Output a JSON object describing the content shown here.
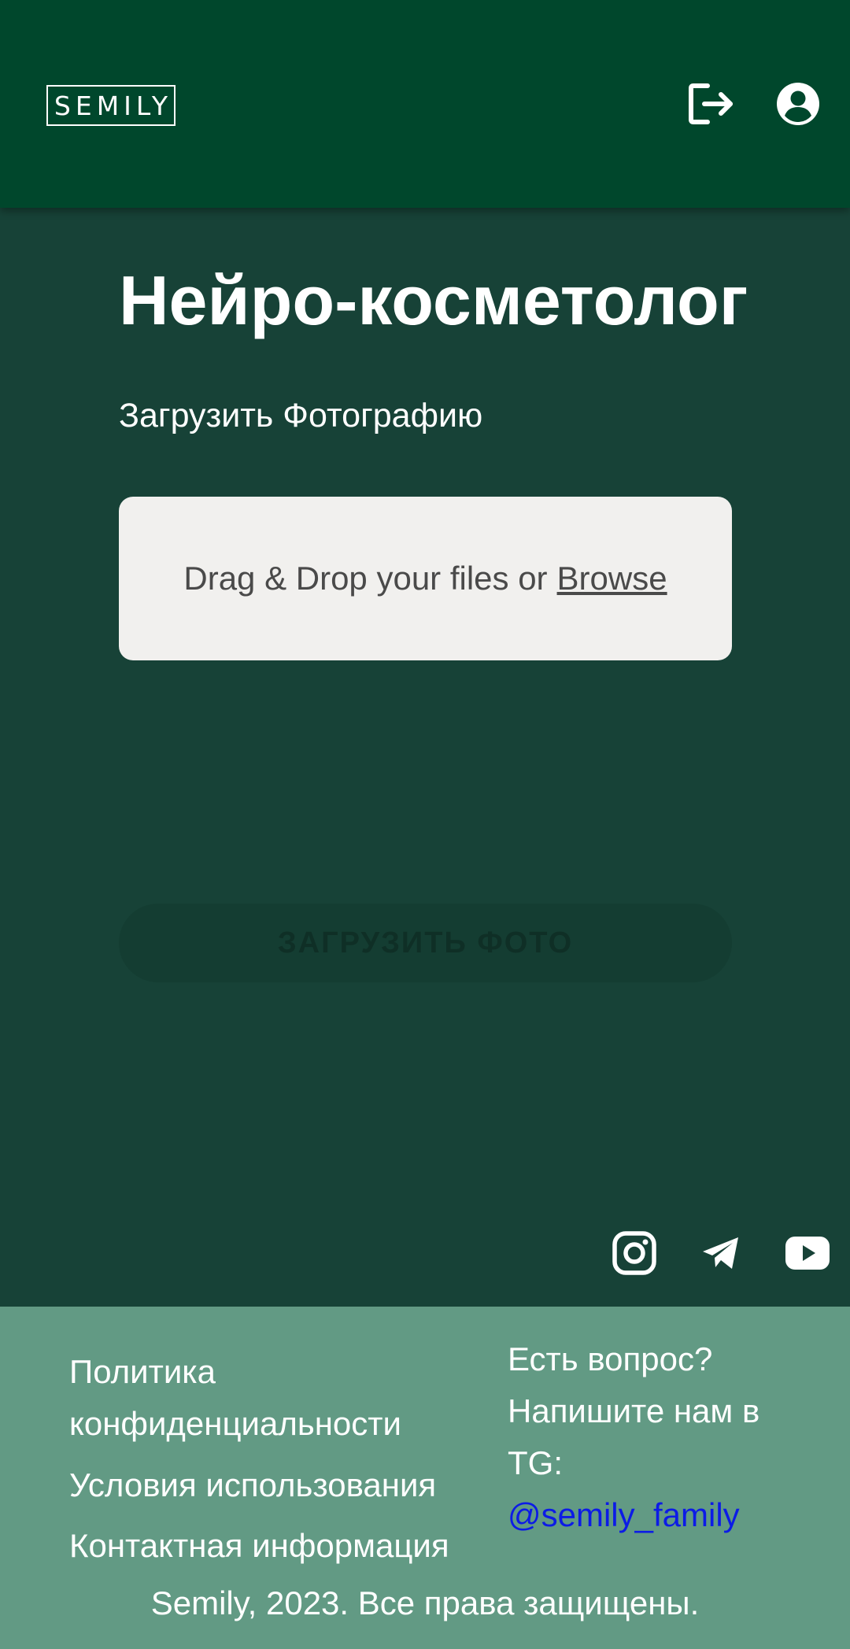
{
  "header": {
    "logo_text": "SEMILY",
    "icons": {
      "logout": "logout-icon",
      "account": "account-circle-icon"
    },
    "colors": {
      "background": "#00472c",
      "icon": "#ffffff"
    }
  },
  "main": {
    "title": "Нейро-косметолог",
    "upload_label": "Загрузить Фотографию",
    "dropzone": {
      "text": "Drag & Drop your files or",
      "browse_link": "Browse"
    },
    "upload_button": {
      "label": "ЗАГРУЗИТЬ ФОТО",
      "state": "disabled"
    },
    "colors": {
      "background": "#174237",
      "dropzone_background": "#f1f0ee"
    }
  },
  "social": {
    "icons": [
      "instagram-icon",
      "telegram-icon",
      "youtube-icon"
    ]
  },
  "footer": {
    "links": {
      "privacy": "Политика конфиденциальности",
      "terms": "Условия использования",
      "contacts": "Контактная информация"
    },
    "contact": {
      "line1": "Есть вопрос?",
      "line2": "Напишите нам в",
      "line3": "TG:",
      "handle": "@semily_family"
    },
    "copyright": "Semily, 2023. Все права защищены.",
    "colors": {
      "background": "#629a84",
      "link": "#0c1be6"
    }
  }
}
